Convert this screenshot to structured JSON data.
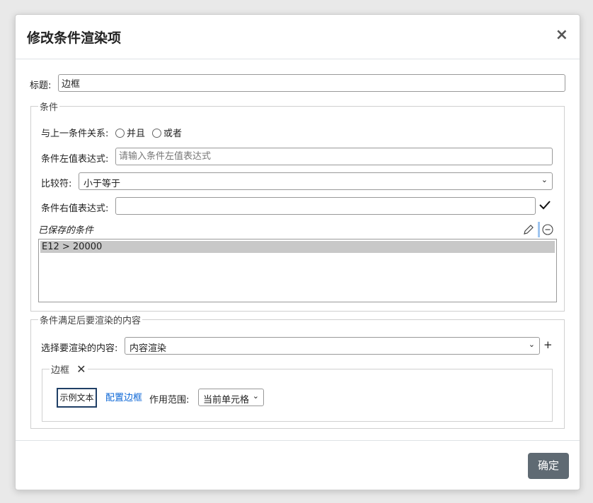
{
  "dialog": {
    "title": "修改条件渲染项",
    "close_label": "×"
  },
  "title_field": {
    "label": "标题:",
    "value": "边框"
  },
  "condition": {
    "legend": "条件",
    "relation_label": "与上一条件关系:",
    "options": [
      "并且",
      "或者"
    ],
    "left_label": "条件左值表达式:",
    "left_placeholder": "请输入条件左值表达式",
    "operator_label": "比较符:",
    "operator_value": "小于等于",
    "right_label": "条件右值表达式:",
    "right_value": "",
    "saved_label": "已保存的条件",
    "saved_items": [
      "E12 > 20000"
    ]
  },
  "render": {
    "legend": "条件满足后要渲染的内容",
    "select_label": "选择要渲染的内容:",
    "select_value": "内容渲染",
    "add_label": "+",
    "border_group": {
      "legend": "边框",
      "remove_label": "✕",
      "sample_text": "示例文本",
      "config_link": "配置边框",
      "scope_label": "作用范围:",
      "scope_value": "当前单元格"
    }
  },
  "footer": {
    "ok_label": "确定"
  },
  "icons": {
    "confirm": "check-icon",
    "edit": "pencil-icon",
    "remove": "minus-circle-icon",
    "dropdown": "chevron-down-icon"
  }
}
